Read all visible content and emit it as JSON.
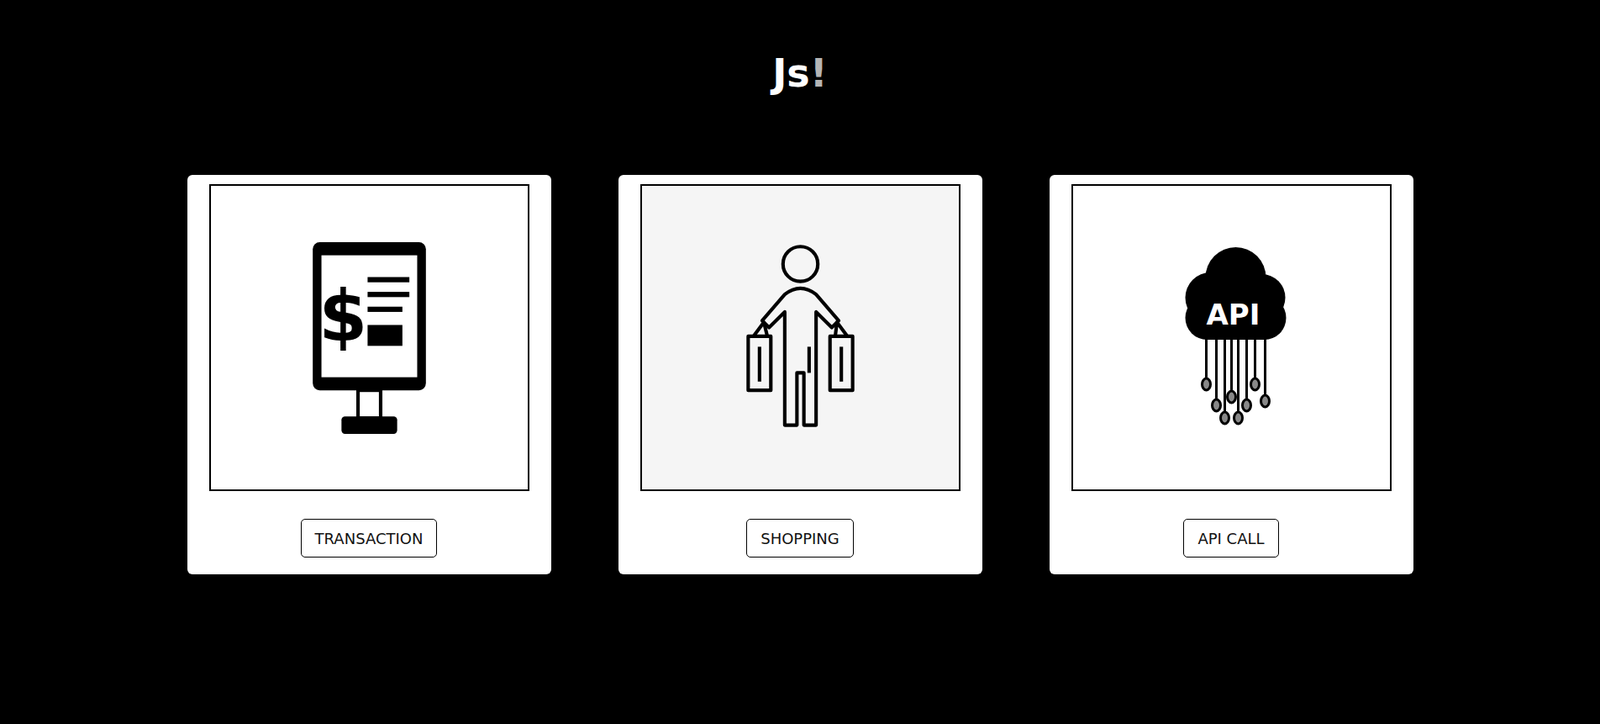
{
  "header": {
    "title": "Js",
    "accent": "!"
  },
  "cards": [
    {
      "kind": "terminal",
      "icon_text": "$",
      "button": "TRANSACTION",
      "highlighted": false
    },
    {
      "kind": "shopper",
      "icon_text": "",
      "button": "SHOPPING",
      "highlighted": true
    },
    {
      "kind": "cloud",
      "icon_text": "API",
      "button": "API CALL",
      "highlighted": false
    }
  ]
}
